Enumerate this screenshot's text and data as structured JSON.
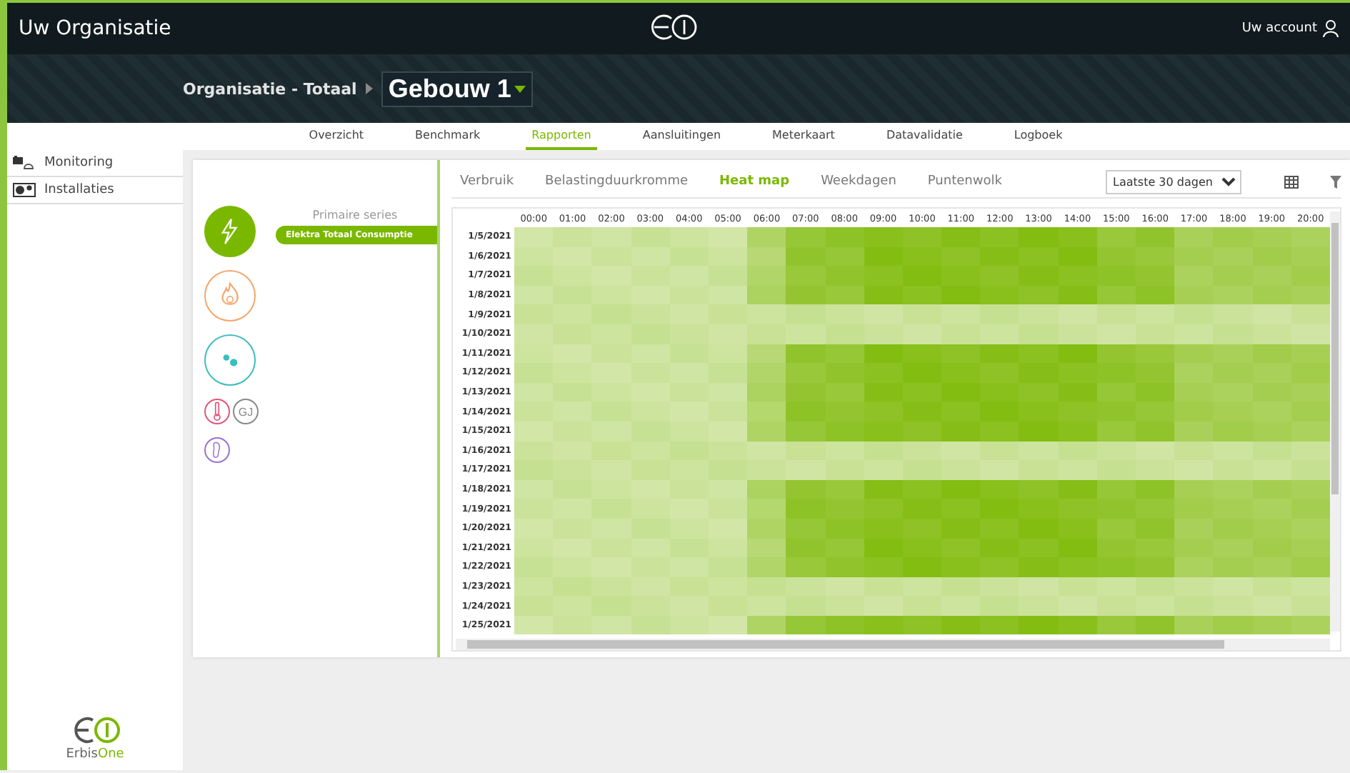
{
  "app": {
    "title": "Uw Organisatie",
    "account": "Uw account"
  },
  "breadcrumb": {
    "parent": "Organisatie - Totaal",
    "current": "Gebouw 1"
  },
  "nav_tabs": [
    {
      "label": "Overzicht",
      "selected": false
    },
    {
      "label": "Benchmark",
      "selected": false
    },
    {
      "label": "Rapporten",
      "selected": true
    },
    {
      "label": "Aansluitingen",
      "selected": false
    },
    {
      "label": "Meterkaart",
      "selected": false
    },
    {
      "label": "Datavalidatie",
      "selected": false
    },
    {
      "label": "Logboek",
      "selected": false
    }
  ],
  "sidebar": {
    "items": [
      {
        "label": "Monitoring",
        "kind": "monitoring"
      },
      {
        "label": "Installaties",
        "kind": "installations"
      }
    ]
  },
  "utilities": [
    {
      "kind": "electricity",
      "selected": true,
      "color": "#7ab800"
    },
    {
      "kind": "gas",
      "selected": false,
      "color": "#f5a66b"
    },
    {
      "kind": "water",
      "selected": false,
      "color": "#3dbdbd"
    },
    {
      "kind": "temperature",
      "selected": false,
      "color": "#e0577a"
    },
    {
      "kind": "energy",
      "selected": false,
      "color": "#8a8a8a",
      "label": "GJ"
    },
    {
      "kind": "footprint",
      "selected": false,
      "color": "#9a72d0"
    }
  ],
  "series": {
    "heading": "Primaire series",
    "items": [
      {
        "label": "Elektra Totaal Consumptie",
        "selected": true
      }
    ]
  },
  "report_tabs": [
    {
      "label": "Verbruik",
      "selected": false
    },
    {
      "label": "Belastingduurkromme",
      "selected": false
    },
    {
      "label": "Heat map",
      "selected": true
    },
    {
      "label": "Weekdagen",
      "selected": false
    },
    {
      "label": "Puntenwolk",
      "selected": false
    }
  ],
  "period_select": {
    "value": "Laatste 30 dagen"
  },
  "heatmap": {
    "columns": [
      "00:00",
      "01:00",
      "02:00",
      "03:00",
      "04:00",
      "05:00",
      "06:00",
      "07:00",
      "08:00",
      "09:00",
      "10:00",
      "11:00",
      "12:00",
      "13:00",
      "14:00",
      "15:00",
      "16:00",
      "17:00",
      "18:00",
      "19:00",
      "20:00"
    ],
    "rows": [
      "1/5/2021",
      "1/6/2021",
      "1/7/2021",
      "1/8/2021",
      "1/9/2021",
      "1/10/2021",
      "1/11/2021",
      "1/12/2021",
      "1/13/2021",
      "1/14/2021",
      "1/15/2021",
      "1/16/2021",
      "1/17/2021",
      "1/18/2021",
      "1/19/2021",
      "1/20/2021",
      "1/21/2021",
      "1/22/2021",
      "1/23/2021",
      "1/24/2021",
      "1/25/2021"
    ]
  },
  "footer_logo": {
    "first": "Erbis",
    "second": "One"
  }
}
